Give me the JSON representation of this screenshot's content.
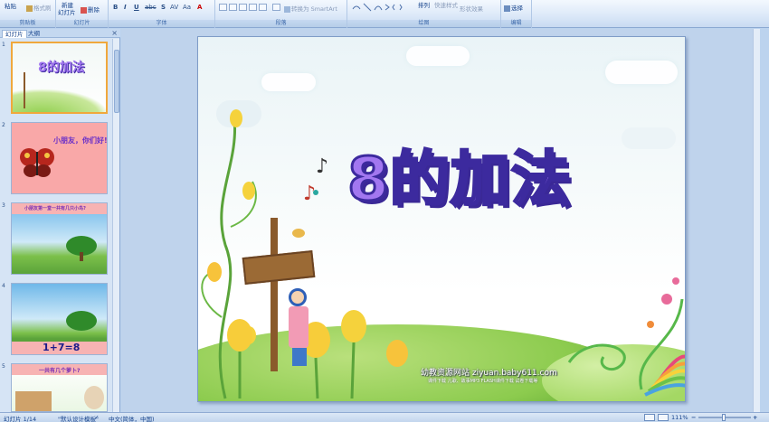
{
  "ribbon": {
    "clipboard": {
      "paste": "粘贴",
      "format_painter": "格式刷",
      "label": "剪贴板"
    },
    "slides": {
      "new_slide_line1": "新建",
      "new_slide_line2": "幻灯片",
      "delete": "删除",
      "label": "幻灯片"
    },
    "font": {
      "bold": "B",
      "italic": "I",
      "underline": "U",
      "strike": "abc",
      "shadow": "S",
      "spacing": "AV",
      "case": "Aa",
      "color": "A",
      "label": "字体"
    },
    "paragraph": {
      "convert_smartart": "转换为 SmartArt",
      "label": "段落"
    },
    "drawing": {
      "arrange": "排列",
      "quick_styles": "快速样式",
      "shape_effects": "形状效果",
      "label": "绘图"
    },
    "editing": {
      "select": "选择",
      "label": "编辑"
    }
  },
  "leftpane": {
    "tabs": [
      "幻灯片",
      "大纲"
    ],
    "close": "×",
    "thumbnails": [
      {
        "num": "1",
        "text": "8的加法"
      },
      {
        "num": "2",
        "text": "小朋友，你们好!"
      },
      {
        "num": "3",
        "text": "小朋友第一堂一共有几只小鸟?"
      },
      {
        "num": "4",
        "text": "1+7=8"
      },
      {
        "num": "5",
        "text": "一共有几个萝卜?"
      }
    ]
  },
  "slide": {
    "title": "8的加法",
    "site": "幼教资源网站  ziyuan.baby611.com",
    "site_sub": "课件下载    儿歌、故事MP3    FLASH课件下载    试卷下载等"
  },
  "status": {
    "slide_counter": "幻灯片 1/14",
    "theme": "\"默认设计模板\"",
    "language": "中文(简体，中国)",
    "zoom": "111%"
  },
  "colors": {
    "accent": "#a277f0",
    "ribbon_text": "#15428b",
    "title_stroke": "#3c2a9e"
  }
}
